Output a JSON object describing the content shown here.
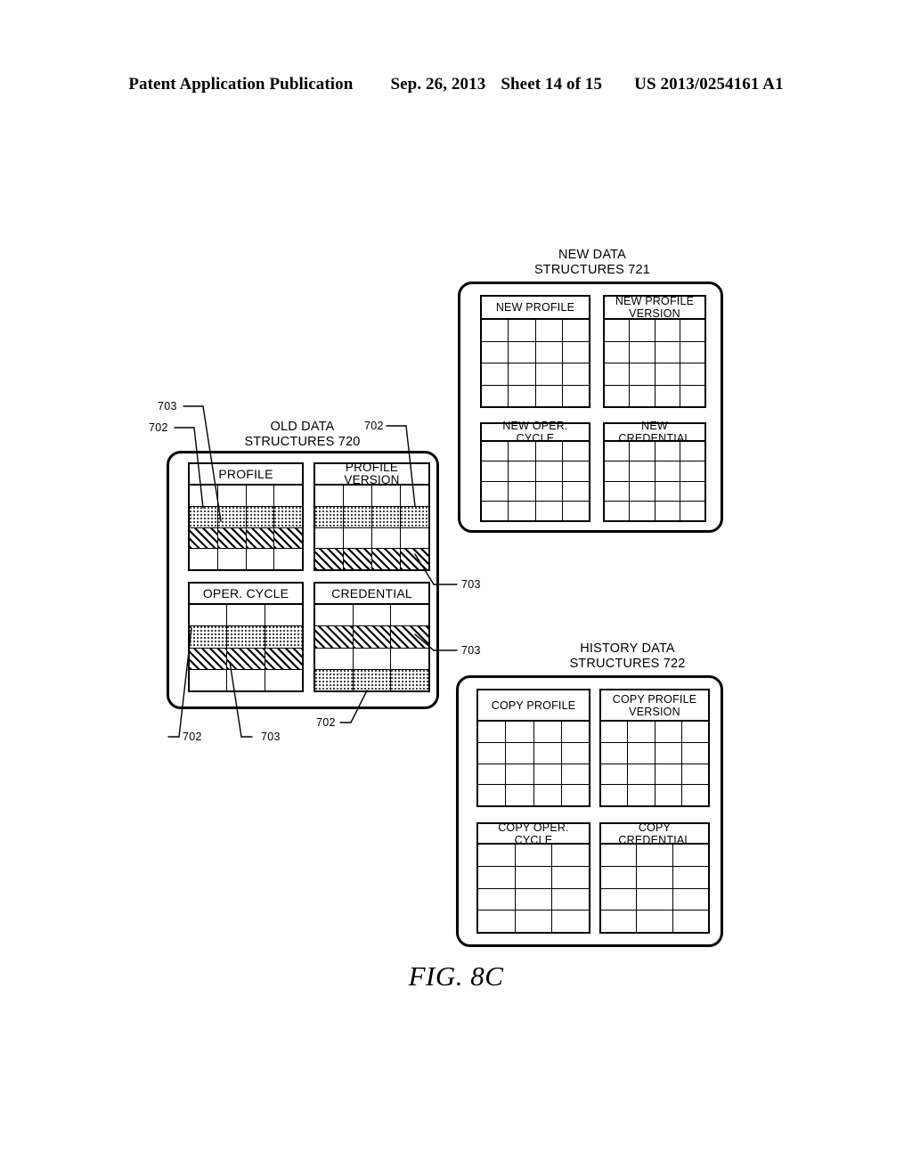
{
  "header": {
    "publication": "Patent Application Publication",
    "date": "Sep. 26, 2013",
    "sheet": "Sheet 14 of 15",
    "patent_number": "US 2013/0254161 A1"
  },
  "figure": {
    "caption": "FIG. 8C",
    "legend": {
      "702_label": "702",
      "703_label": "703",
      "702_meaning": "dotted-fill-record",
      "703_meaning": "hatched-fill-record"
    },
    "groups": [
      {
        "id": "new",
        "caption": "NEW DATA\nSTRUCTURES 721",
        "ref": "721",
        "tables": [
          {
            "id": "new-profile",
            "title": "NEW PROFILE",
            "cols": 4,
            "rows": 4,
            "fills": [
              "none",
              "none",
              "none",
              "none"
            ]
          },
          {
            "id": "new-profile-version",
            "title": "NEW PROFILE\nVERSION",
            "cols": 4,
            "rows": 4,
            "fills": [
              "none",
              "none",
              "none",
              "none"
            ]
          },
          {
            "id": "new-oper-cycle",
            "title": "NEW OPER. CYCLE",
            "cols": 4,
            "rows": 4,
            "fills": [
              "none",
              "none",
              "none",
              "none"
            ]
          },
          {
            "id": "new-credential",
            "title": "NEW CREDENTIAL",
            "cols": 4,
            "rows": 4,
            "fills": [
              "none",
              "none",
              "none",
              "none"
            ]
          }
        ]
      },
      {
        "id": "old",
        "caption": "OLD DATA\nSTRUCTURES 720",
        "ref": "720",
        "tables": [
          {
            "id": "profile",
            "title": "PROFILE",
            "cols": 4,
            "rows": 4,
            "fills": [
              "none",
              "dot",
              "hatch",
              "none"
            ]
          },
          {
            "id": "profile-version",
            "title": "PROFILE VERSION",
            "cols": 4,
            "rows": 4,
            "fills": [
              "none",
              "dot",
              "none",
              "hatch"
            ]
          },
          {
            "id": "oper-cycle",
            "title": "OPER. CYCLE",
            "cols": 3,
            "rows": 4,
            "fills": [
              "none",
              "dot",
              "hatch",
              "none"
            ]
          },
          {
            "id": "credential",
            "title": "CREDENTIAL",
            "cols": 3,
            "rows": 4,
            "fills": [
              "none",
              "hatch",
              "none",
              "dot"
            ]
          }
        ]
      },
      {
        "id": "history",
        "caption": "HISTORY DATA\nSTRUCTURES 722",
        "ref": "722",
        "tables": [
          {
            "id": "copy-profile",
            "title": "COPY  PROFILE",
            "cols": 4,
            "rows": 4,
            "fills": [
              "none",
              "none",
              "none",
              "none"
            ]
          },
          {
            "id": "copy-profile-version",
            "title": "COPY  PROFILE\nVERSION",
            "cols": 4,
            "rows": 4,
            "fills": [
              "none",
              "none",
              "none",
              "none"
            ]
          },
          {
            "id": "copy-oper-cycle",
            "title": "COPY OPER. CYCLE",
            "cols": 3,
            "rows": 4,
            "fills": [
              "none",
              "none",
              "none",
              "none"
            ]
          },
          {
            "id": "copy-credential",
            "title": "COPY CREDENTIAL",
            "cols": 3,
            "rows": 4,
            "fills": [
              "none",
              "none",
              "none",
              "none"
            ]
          }
        ]
      }
    ],
    "callouts": [
      {
        "id": "c-703-tl",
        "text": "703"
      },
      {
        "id": "c-702-tl",
        "text": "702"
      },
      {
        "id": "c-702-tr",
        "text": "702"
      },
      {
        "id": "c-703-r1",
        "text": "703"
      },
      {
        "id": "c-703-r2",
        "text": "703"
      },
      {
        "id": "c-702-bl",
        "text": "702"
      },
      {
        "id": "c-703-bm",
        "text": "703"
      },
      {
        "id": "c-702-bm",
        "text": "702"
      }
    ]
  }
}
